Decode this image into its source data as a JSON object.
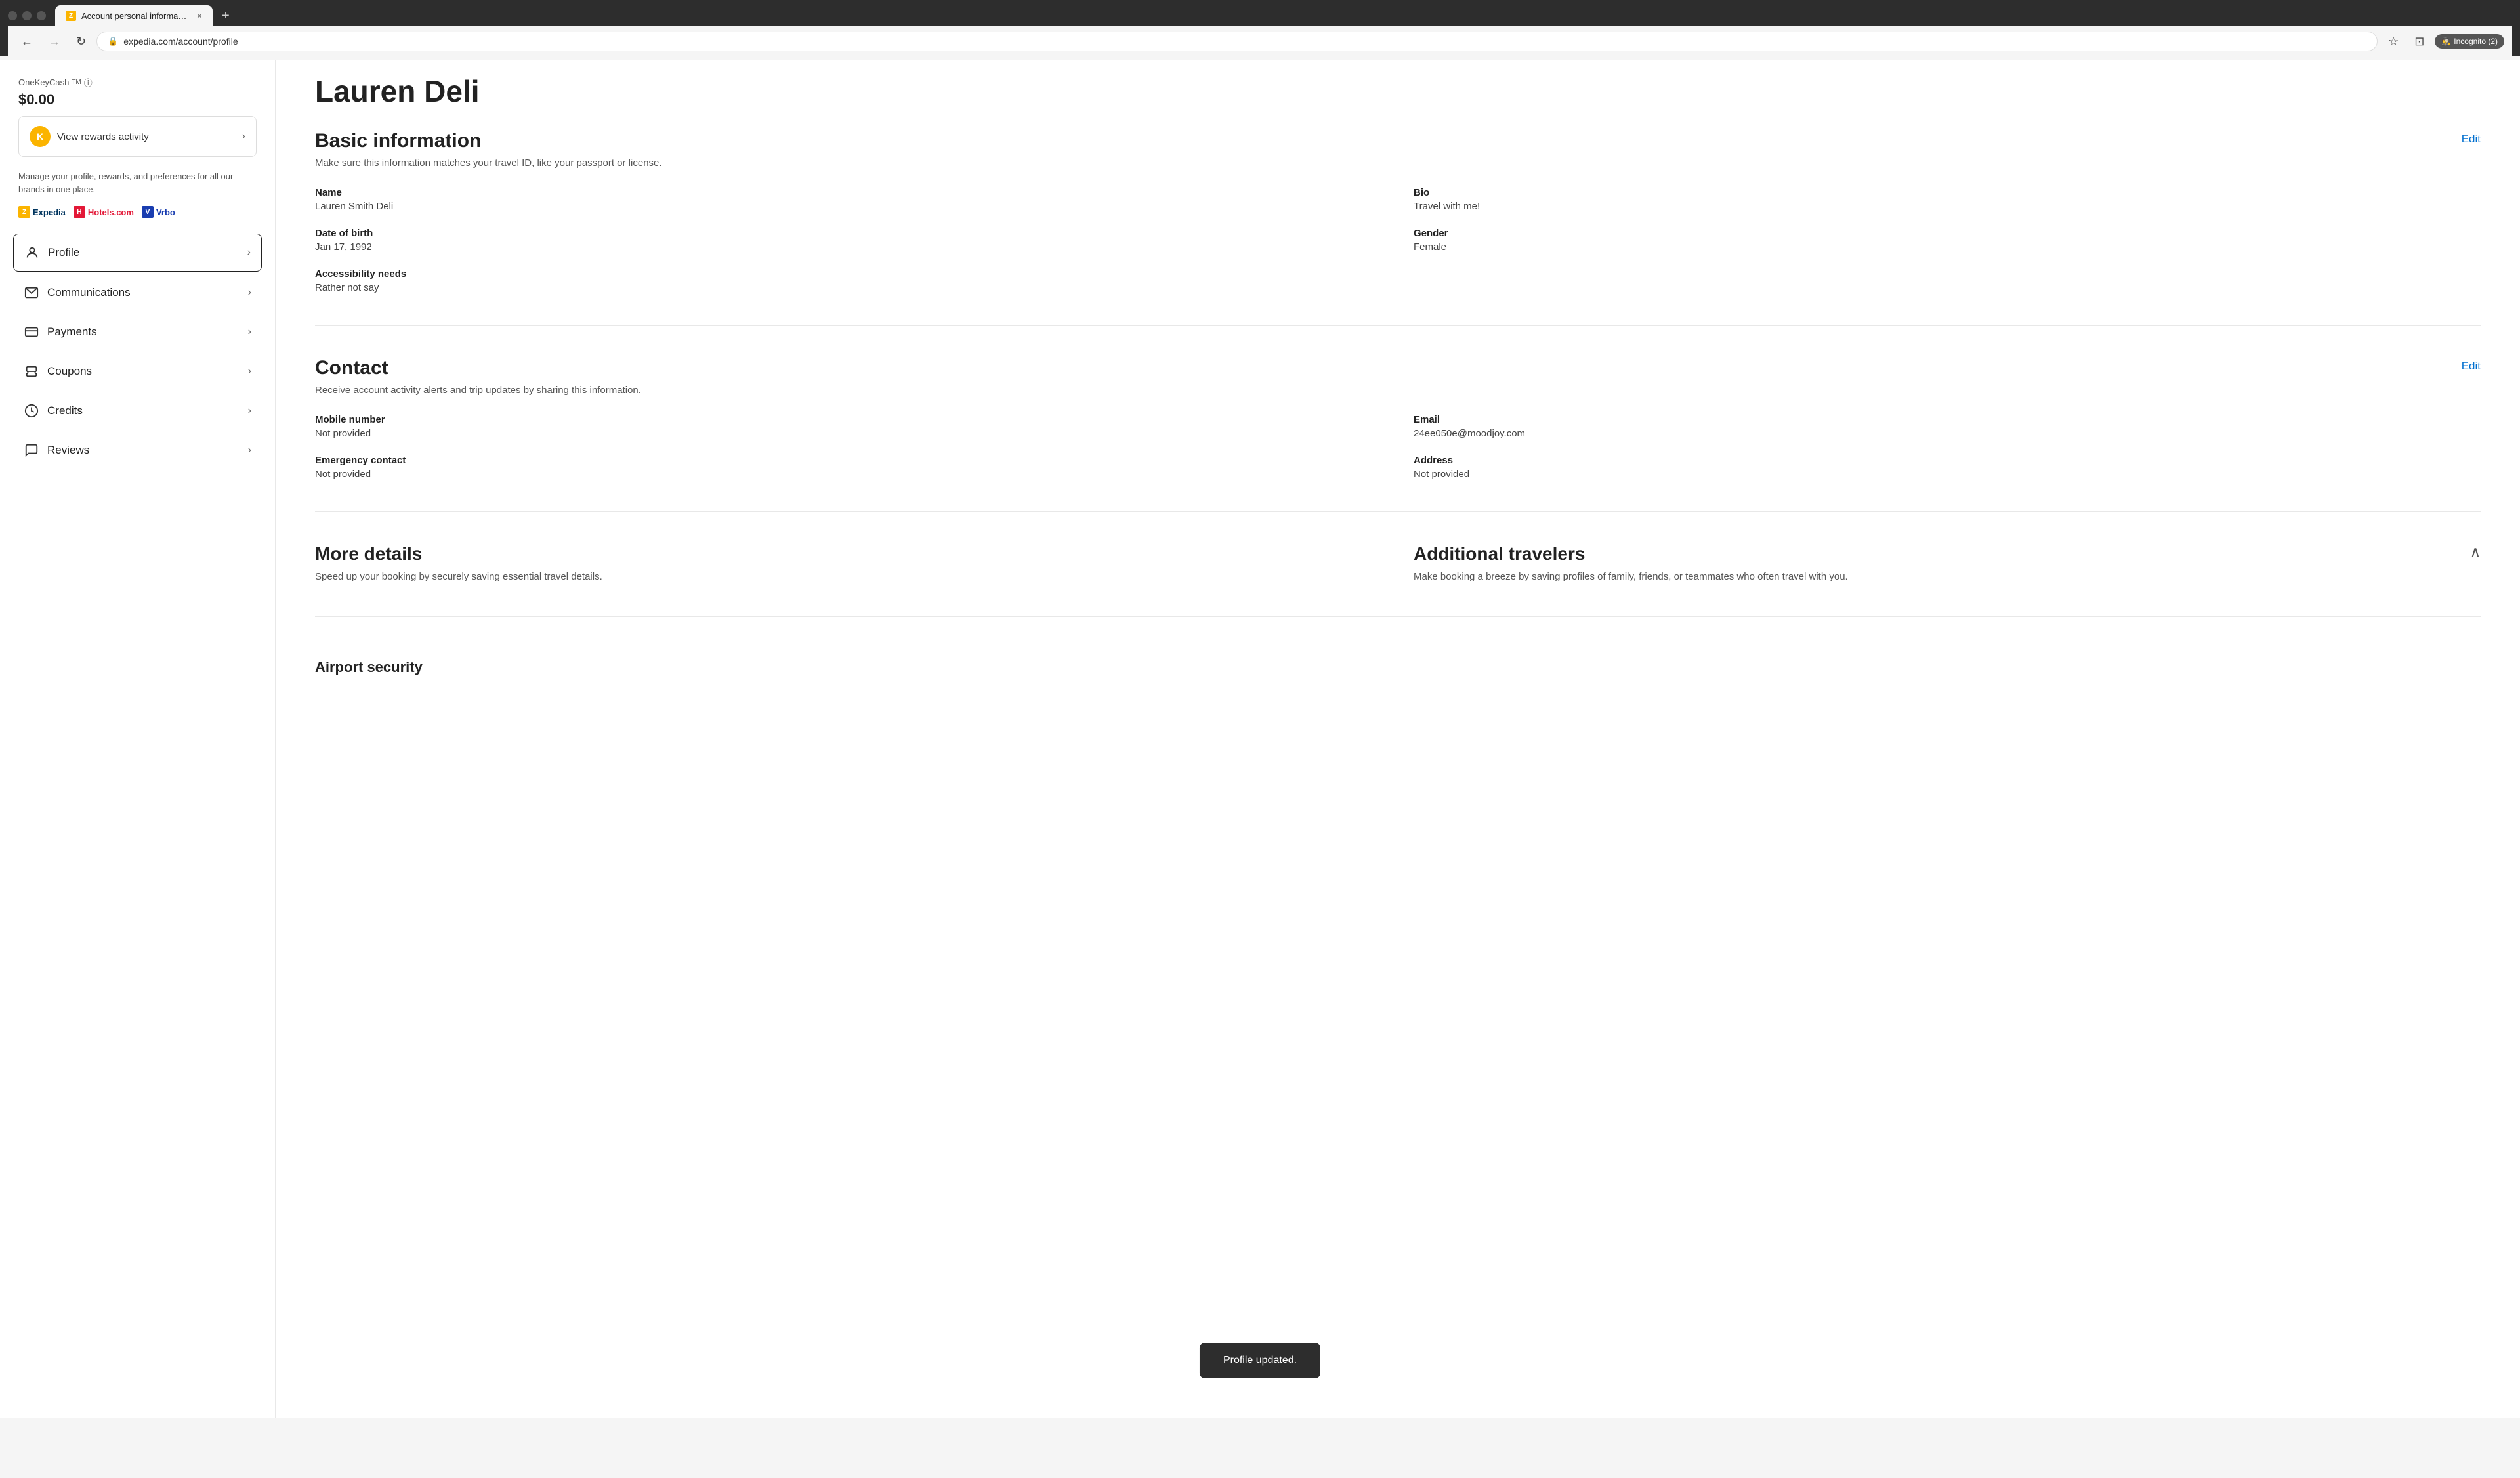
{
  "browser": {
    "tab_favicon": "Z",
    "tab_title": "Account personal information",
    "tab_close": "×",
    "tab_new": "+",
    "url": "expedia.com/account/profile",
    "nav_back_enabled": true,
    "nav_forward_enabled": false,
    "incognito_label": "Incognito (2)"
  },
  "sidebar": {
    "onekey_label": "OneKeyCash",
    "onekey_tm": "TM",
    "onekey_amount": "$0.00",
    "view_rewards_label": "View rewards activity",
    "manage_text": "Manage your profile, rewards, and preferences for all our brands in one place.",
    "brands": [
      {
        "name": "Expedia",
        "type": "expedia"
      },
      {
        "name": "Hotels.com",
        "type": "hotels"
      },
      {
        "name": "Vrbo",
        "type": "vrbo"
      }
    ],
    "nav_items": [
      {
        "id": "profile",
        "label": "Profile",
        "icon": "👤",
        "active": true
      },
      {
        "id": "communications",
        "label": "Communications",
        "icon": "✉️",
        "active": false
      },
      {
        "id": "payments",
        "label": "Payments",
        "icon": "💳",
        "active": false
      },
      {
        "id": "coupons",
        "label": "Coupons",
        "icon": "🏷️",
        "active": false
      },
      {
        "id": "credits",
        "label": "Credits",
        "icon": "⊙",
        "active": false
      },
      {
        "id": "reviews",
        "label": "Reviews",
        "icon": "💬",
        "active": false
      }
    ]
  },
  "main": {
    "user_name": "Lauren Deli",
    "basic_info": {
      "title": "Basic information",
      "subtitle": "Make sure this information matches your travel ID, like your passport or license.",
      "edit_label": "Edit",
      "fields": [
        {
          "label": "Name",
          "value": "Lauren Smith Deli"
        },
        {
          "label": "Bio",
          "value": "Travel with me!"
        },
        {
          "label": "Date of birth",
          "value": "Jan 17, 1992"
        },
        {
          "label": "Gender",
          "value": "Female"
        },
        {
          "label": "Accessibility needs",
          "value": "Rather not say"
        },
        {
          "label": "",
          "value": ""
        }
      ]
    },
    "contact": {
      "title": "Contact",
      "subtitle": "Receive account activity alerts and trip updates by sharing this information.",
      "edit_label": "Edit",
      "fields": [
        {
          "label": "Mobile number",
          "value": "Not provided"
        },
        {
          "label": "Email",
          "value": "24ee050e@moodjoy.com"
        },
        {
          "label": "Emergency contact",
          "value": "Not provided"
        },
        {
          "label": "Address",
          "value": "Not provided"
        }
      ]
    },
    "more_details": {
      "title": "More details",
      "subtitle": "Speed up your booking by securely saving essential travel details."
    },
    "additional_travelers": {
      "title": "Additional travelers",
      "subtitle": "Make booking a breeze by saving profiles of family, friends, or teammates who often travel with you."
    },
    "airport_security": {
      "title": "Airport security"
    }
  },
  "toast": {
    "message": "Profile updated."
  }
}
